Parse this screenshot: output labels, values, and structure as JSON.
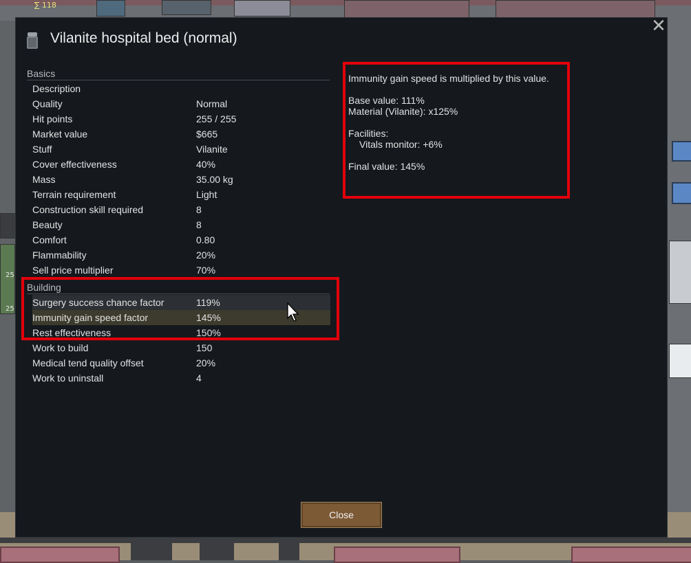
{
  "dialog": {
    "title": "Vilanite hospital bed (normal)",
    "close_button": "Close",
    "close_icon": "close-x-icon",
    "title_icon": "hospital-bed-icon"
  },
  "basics": {
    "header": "Basics",
    "rows": [
      {
        "label": "Description",
        "value": ""
      },
      {
        "label": "Quality",
        "value": "Normal"
      },
      {
        "label": "Hit points",
        "value": "255 / 255"
      },
      {
        "label": "Market value",
        "value": "$665"
      },
      {
        "label": "Stuff",
        "value": "Vilanite"
      },
      {
        "label": "Cover effectiveness",
        "value": "40%"
      },
      {
        "label": "Mass",
        "value": "35.00 kg"
      },
      {
        "label": "Terrain requirement",
        "value": "Light"
      },
      {
        "label": "Construction skill required",
        "value": "8"
      },
      {
        "label": "Beauty",
        "value": "8"
      },
      {
        "label": "Comfort",
        "value": "0.80"
      },
      {
        "label": "Flammability",
        "value": "20%"
      },
      {
        "label": "Sell price multiplier",
        "value": "70%"
      }
    ]
  },
  "building": {
    "header": "Building",
    "rows": [
      {
        "label": "Surgery success chance factor",
        "value": "119%"
      },
      {
        "label": "Immunity gain speed factor",
        "value": "145%"
      },
      {
        "label": "Rest effectiveness",
        "value": "150%"
      },
      {
        "label": "Work to build",
        "value": "150"
      },
      {
        "label": "Medical tend quality offset",
        "value": "20%"
      },
      {
        "label": "Work to uninstall",
        "value": "4"
      }
    ]
  },
  "info": {
    "description": "Immunity gain speed is multiplied by this value.",
    "base_value": "Base value: 111%",
    "material": "Material (Vilanite): x125%",
    "facilities_header": "Facilities:",
    "facility_1": "Vitals monitor: +6%",
    "final_value": "Final value: 145%"
  },
  "background": {
    "top_counter": "∑ 118",
    "left_num_1": "25",
    "left_num_2": "25"
  },
  "colors": {
    "highlight": "#e3000a",
    "dialog_bg": "#15191e",
    "button_bg": "#7d5a36"
  }
}
